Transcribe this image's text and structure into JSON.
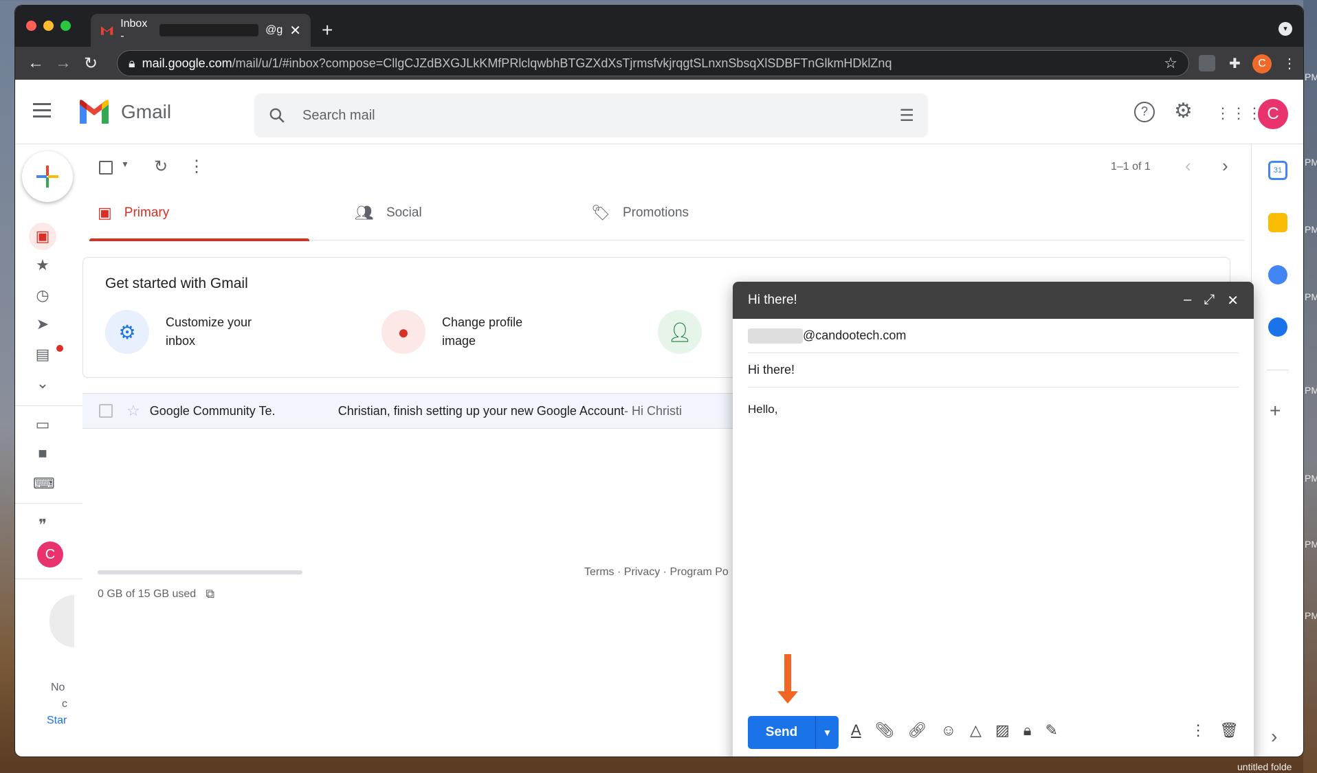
{
  "browser": {
    "tab_title": "Inbox - ",
    "tab_title_suffix": "@g",
    "url_domain": "mail.google.com",
    "url_path": "/mail/u/1/#inbox?compose=CllgCJZdBXGJLkKMfPRlclqwbhBTGZXdXsTjrmsfvkjrqgtSLnxnSbsqXlSDBFTnGlkmHDklZnq",
    "profile_initial": "C"
  },
  "gmail": {
    "logo_text": "Gmail",
    "search_placeholder": "Search mail",
    "avatar_initial": "C",
    "pagination": "1–1 of 1",
    "tabs": [
      {
        "label": "Primary"
      },
      {
        "label": "Social"
      },
      {
        "label": "Promotions"
      }
    ],
    "get_started": {
      "title": "Get started with Gmail",
      "items": [
        {
          "line1": "Customize your",
          "line2": "inbox"
        },
        {
          "line1": "Change profile",
          "line2": "image"
        }
      ]
    },
    "email": {
      "sender": "Google Community Te.",
      "subject": "Christian, finish setting up your new Google Account",
      "snippet": " - Hi Christi"
    },
    "storage": "0 GB of 15 GB used",
    "footer": "Terms · Privacy · Program Po",
    "rail_avatar": "C",
    "rail_text": {
      "a": "No",
      "b": "c",
      "c": "Star"
    }
  },
  "compose": {
    "title": "Hi there!",
    "to_suffix": "@candootech.com",
    "subject": "Hi there!",
    "body": "Hello,",
    "send_label": "Send"
  },
  "desktop": {
    "folder_label": "untitled folde",
    "pm_label": "PM"
  },
  "colors": {
    "send_blue": "#1a73e8",
    "primary_red": "#d93025",
    "arrow_orange": "#f26522",
    "avatar_pink": "#e8336d"
  }
}
